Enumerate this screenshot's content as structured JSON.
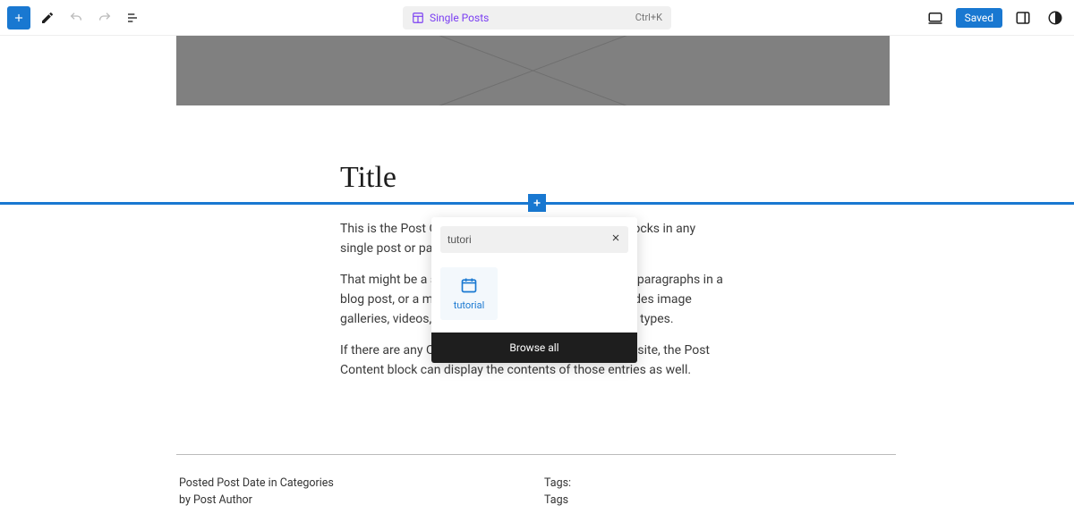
{
  "topbar": {
    "center_label": "Single Posts",
    "shortcut": "Ctrl+K",
    "saved_label": "Saved"
  },
  "post": {
    "title": "Title",
    "p1": "This is the Post Content block, it will display all the blocks in any single post or page.",
    "p2": "That might be a simple arrangement like consecutive paragraphs in a blog post, or a more elaborate composition that includes image galleries, videos, tables, columns, and any other block types.",
    "p3": "If there are any Custom Post Types registered at your site, the Post Content block can display the contents of those entries as well."
  },
  "inserter": {
    "search_value": "tutori",
    "block_label": "tutorial",
    "browse_all": "Browse all"
  },
  "meta": {
    "line1": "Posted  Post Date  in  Categories",
    "line2": "by  Post Author",
    "tags_label": "Tags:",
    "tags_value": "Tags"
  }
}
